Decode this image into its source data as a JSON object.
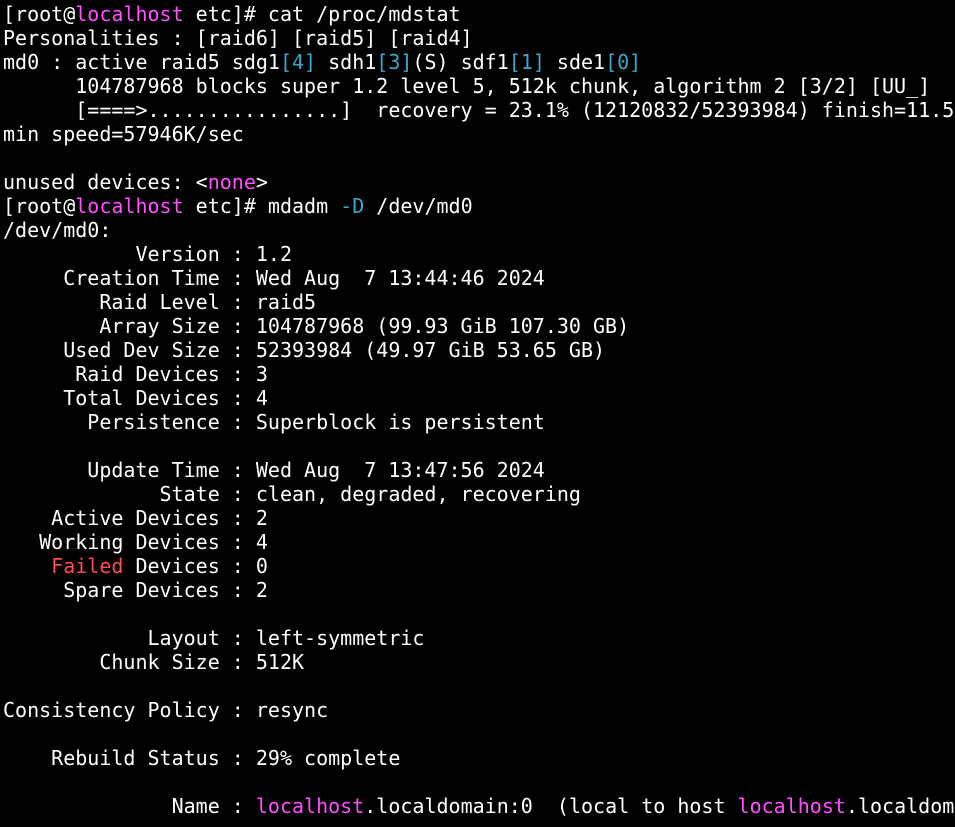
{
  "terminal": {
    "lines": [
      [
        [
          "[root@",
          "plain"
        ],
        [
          "localhost",
          "host"
        ],
        [
          " etc]# cat /proc/mdstat",
          "plain"
        ]
      ],
      [
        [
          "Personalities : [raid6] [raid5] [raid4]",
          "plain"
        ]
      ],
      [
        [
          "md0 : active raid5 sdg1",
          "plain"
        ],
        [
          "[4]",
          "idx"
        ],
        [
          " sdh1",
          "plain"
        ],
        [
          "[3]",
          "idx"
        ],
        [
          "(S) sdf1",
          "plain"
        ],
        [
          "[1]",
          "idx"
        ],
        [
          " sde1",
          "plain"
        ],
        [
          "[0]",
          "idx"
        ]
      ],
      [
        [
          "      104787968 blocks super 1.2 level 5, 512k chunk, algorithm 2 [3/2] [UU_]",
          "plain"
        ]
      ],
      [
        [
          "      [====>................]  recovery = 23.1% (12120832/52393984) finish=11.5",
          "plain"
        ]
      ],
      [
        [
          "min speed=57946K/sec",
          "plain"
        ]
      ],
      [
        [
          "",
          "plain"
        ]
      ],
      [
        [
          "unused devices: <",
          "plain"
        ],
        [
          "none",
          "none"
        ],
        [
          ">",
          "plain"
        ]
      ],
      [
        [
          "[root@",
          "plain"
        ],
        [
          "localhost",
          "host"
        ],
        [
          " etc]# mdadm ",
          "plain"
        ],
        [
          "-D",
          "opt"
        ],
        [
          " /dev/md0",
          "plain"
        ]
      ],
      [
        [
          "/dev/md0:",
          "plain"
        ]
      ],
      [
        [
          "           Version : 1.2",
          "plain"
        ]
      ],
      [
        [
          "     Creation Time : Wed Aug  7 13:44:46 2024",
          "plain"
        ]
      ],
      [
        [
          "        Raid Level : raid5",
          "plain"
        ]
      ],
      [
        [
          "        Array Size : 104787968 (99.93 GiB 107.30 GB)",
          "plain"
        ]
      ],
      [
        [
          "     Used Dev Size : 52393984 (49.97 GiB 53.65 GB)",
          "plain"
        ]
      ],
      [
        [
          "      Raid Devices : 3",
          "plain"
        ]
      ],
      [
        [
          "     Total Devices : 4",
          "plain"
        ]
      ],
      [
        [
          "       Persistence : Superblock is persistent",
          "plain"
        ]
      ],
      [
        [
          "",
          "plain"
        ]
      ],
      [
        [
          "       Update Time : Wed Aug  7 13:47:56 2024",
          "plain"
        ]
      ],
      [
        [
          "             State : clean, degraded, recovering",
          "plain"
        ]
      ],
      [
        [
          "    Active Devices : 2",
          "plain"
        ]
      ],
      [
        [
          "   Working Devices : 4",
          "plain"
        ]
      ],
      [
        [
          "    ",
          "plain"
        ],
        [
          "Failed",
          "fail"
        ],
        [
          " Devices : 0",
          "plain"
        ]
      ],
      [
        [
          "     Spare Devices : 2",
          "plain"
        ]
      ],
      [
        [
          "",
          "plain"
        ]
      ],
      [
        [
          "            Layout : left-symmetric",
          "plain"
        ]
      ],
      [
        [
          "        Chunk Size : 512K",
          "plain"
        ]
      ],
      [
        [
          "",
          "plain"
        ]
      ],
      [
        [
          "Consistency Policy : resync",
          "plain"
        ]
      ],
      [
        [
          "",
          "plain"
        ]
      ],
      [
        [
          "    Rebuild Status : 29% complete",
          "plain"
        ]
      ],
      [
        [
          "",
          "plain"
        ]
      ],
      [
        [
          "              Name : ",
          "plain"
        ],
        [
          "localhost",
          "host"
        ],
        [
          ".localdomain:0  (local to host ",
          "plain"
        ],
        [
          "localhost",
          "host"
        ],
        [
          ".localdom",
          "plain"
        ]
      ]
    ]
  }
}
